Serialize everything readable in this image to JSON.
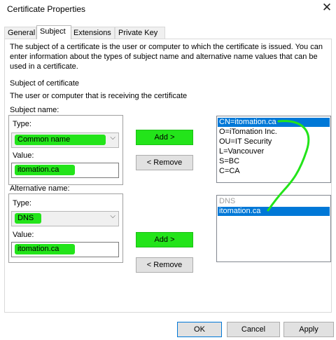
{
  "window": {
    "title": "Certificate Properties",
    "close_glyph": "✕"
  },
  "tabs": [
    {
      "label": "General"
    },
    {
      "label": "Subject"
    },
    {
      "label": "Extensions"
    },
    {
      "label": "Private Key"
    }
  ],
  "subject_tab": {
    "intro": "The subject of a certificate is the user or computer to which the certificate is issued. You can enter information about the types of subject name and alternative name values that can be used in a certificate.",
    "subject_of_certificate": "Subject of certificate",
    "receiving_text": "The user or computer that is receiving the certificate",
    "subject_name": {
      "legend": "Subject name:",
      "type_label": "Type:",
      "type_value": "Common name",
      "value_label": "Value:",
      "value": "itomation.ca",
      "add_label": "Add >",
      "remove_label": "< Remove",
      "list": [
        "CN=itomation.ca",
        "O=iTomation Inc.",
        "OU=IT Security",
        "L=Vancouver",
        "S=BC",
        "C=CA"
      ]
    },
    "alternative_name": {
      "legend": "Alternative name:",
      "type_label": "Type:",
      "type_value": "DNS",
      "value_label": "Value:",
      "value": "itomation.ca",
      "add_label": "Add >",
      "remove_label": "< Remove",
      "list_header": "DNS",
      "list": [
        "itomation.ca"
      ]
    }
  },
  "buttons": {
    "ok": "OK",
    "cancel": "Cancel",
    "apply": "Apply"
  },
  "colors": {
    "highlight": "#23e41a",
    "selection": "#0078d7"
  }
}
